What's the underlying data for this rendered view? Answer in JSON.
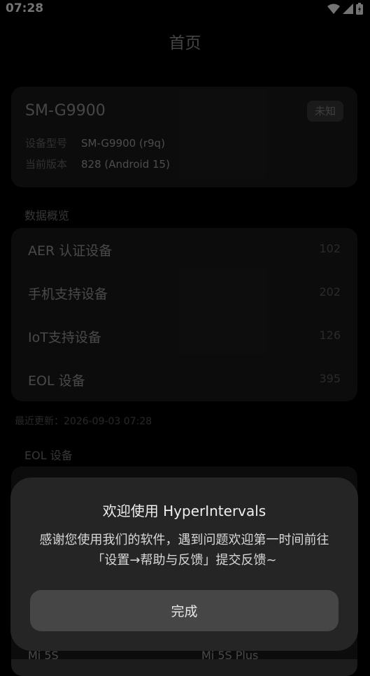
{
  "status_bar": {
    "time": "07:28"
  },
  "header": {
    "title": "首页"
  },
  "device": {
    "name": "SM-G9900",
    "badge": "未知",
    "model_label": "设备型号",
    "model_value": "SM-G9900 (r9q)",
    "version_label": "当前版本",
    "version_value": "828 (Android 15)"
  },
  "overview": {
    "section_title": "数据概览",
    "rows": [
      {
        "label": "AER 认证设备",
        "value": "102"
      },
      {
        "label": "手机支持设备",
        "value": "202"
      },
      {
        "label": "IoT支持设备",
        "value": "126"
      },
      {
        "label": "EOL 设备",
        "value": "395"
      }
    ],
    "last_updated": "最近更新：2026-09-03 07:28"
  },
  "eol": {
    "section_title": "EOL 设备",
    "items": [
      "Mi 5S",
      "Mi 5S Plus"
    ]
  },
  "dialog": {
    "title": "欢迎使用 HyperIntervals",
    "message_line1": "感谢您使用我们的软件，遇到问题欢迎第一时间前往",
    "message_line2": "「设置→帮助与反馈」提交反馈~",
    "confirm_label": "完成"
  }
}
